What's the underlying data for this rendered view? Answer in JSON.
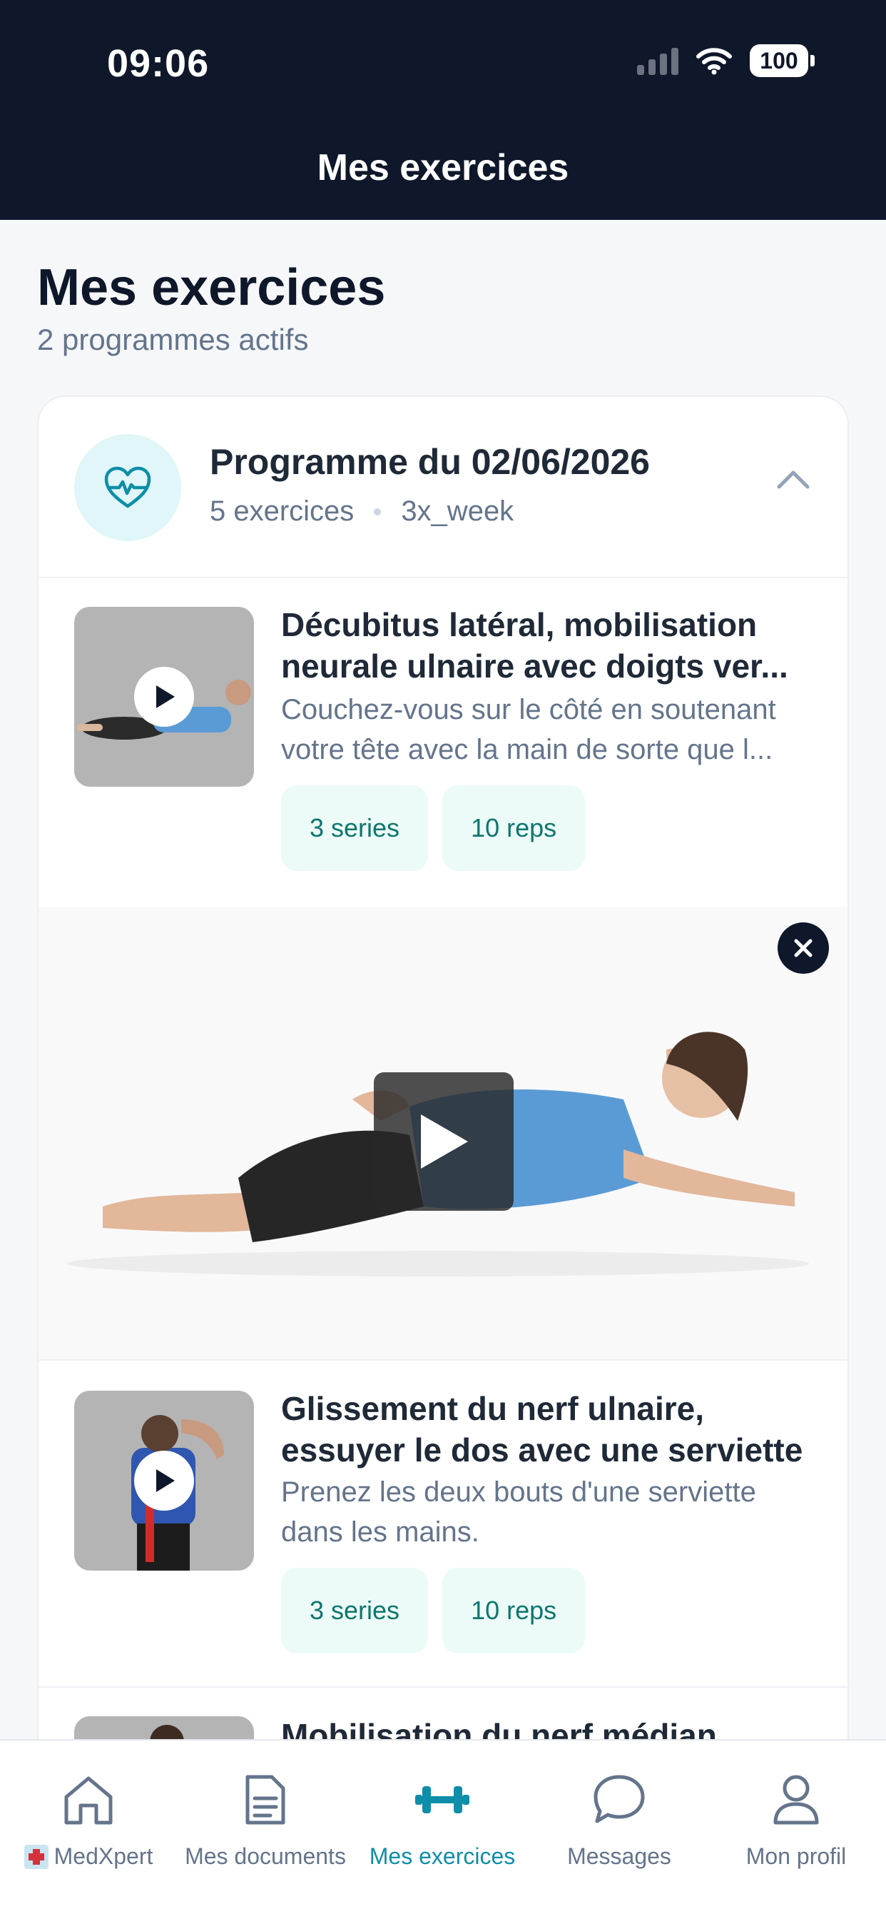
{
  "status_bar": {
    "time": "09:06",
    "battery": "100"
  },
  "nav": {
    "title": "Mes exercices"
  },
  "page": {
    "title": "Mes exercices",
    "subtitle": "2 programmes actifs"
  },
  "program": {
    "title": "Programme du 02/06/2026",
    "exercise_count": "5 exercices",
    "frequency": "3x_week",
    "icon": "heart-pulse-icon",
    "accent": "#0e8ea8"
  },
  "exercises": [
    {
      "title": "Décubitus latéral, mobilisation neurale ulnaire avec doigts ver...",
      "description": "Couchez-vous sur le côté en soutenant votre tête avec la main de sorte que l...",
      "series": "3 series",
      "reps": "10 reps"
    },
    {
      "title": "Glissement du nerf ulnaire, essuyer le dos avec une serviette",
      "description": "Prenez les deux bouts d'une serviette dans les mains.",
      "series": "3 series",
      "reps": "10 reps"
    },
    {
      "title": "Mobilisation du nerf médian"
    }
  ],
  "tabs": [
    {
      "label": "MedXpert",
      "icon": "home-icon"
    },
    {
      "label": "Mes documents",
      "icon": "document-icon"
    },
    {
      "label": "Mes exercices",
      "icon": "dumbbell-icon",
      "active": true
    },
    {
      "label": "Messages",
      "icon": "chat-bubble-icon"
    },
    {
      "label": "Mon profil",
      "icon": "user-icon"
    }
  ]
}
